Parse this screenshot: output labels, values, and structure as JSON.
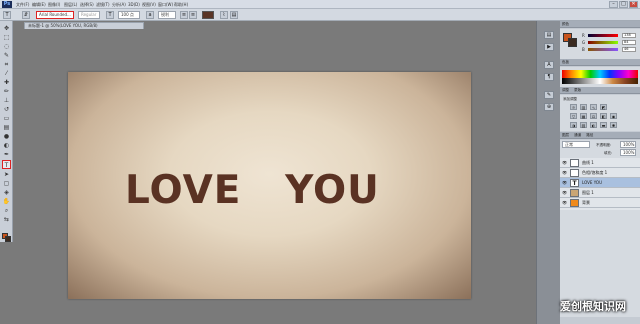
{
  "app": {
    "logo": "Ps"
  },
  "menu": [
    "文件(F)",
    "编辑(E)",
    "图像(I)",
    "图层(L)",
    "选择(S)",
    "滤镜(T)",
    "分析(A)",
    "3D(D)",
    "视图(V)",
    "窗口(W)",
    "帮助(H)"
  ],
  "window_controls": {
    "minimize": "–",
    "restore": "□",
    "close": "✕"
  },
  "options": {
    "font_family": "Arial Rounded...",
    "font_style": "Regular",
    "font_size": "100 点",
    "aa_mode": "锐利"
  },
  "document": {
    "tab_label": "未标题-1 @ 50%(LOVE  YOU, RGB/8)",
    "text": "LOVE   YOU"
  },
  "colors": {
    "text_color": "#5a3223",
    "foreground": "#c8541d",
    "background": "#3a2a20",
    "selection_outline": "#dd2222"
  },
  "panels": {
    "color_tab": "颜色",
    "swatches_tab": "色板",
    "adjustments_tab": "调整",
    "masks_tab": "蒙版",
    "add_adjustment": "添加调整",
    "layers_tab": "图层",
    "channels_tab": "通道",
    "paths_tab": "路径",
    "blend_mode": "正常",
    "opacity_label": "不透明度:",
    "opacity": "100%",
    "fill_label": "填充:",
    "fill": "100%",
    "sliders": [
      {
        "label": "R",
        "value": "138"
      },
      {
        "label": "G",
        "value": "84"
      },
      {
        "label": "B",
        "value": "46"
      }
    ],
    "layers": [
      {
        "name": "曲线 1"
      },
      {
        "name": "色相/饱和度 1"
      },
      {
        "name": "LOVE   YOU"
      },
      {
        "name": "图层 1"
      },
      {
        "name": "背景"
      }
    ]
  },
  "watermark": "爱创根知识网"
}
